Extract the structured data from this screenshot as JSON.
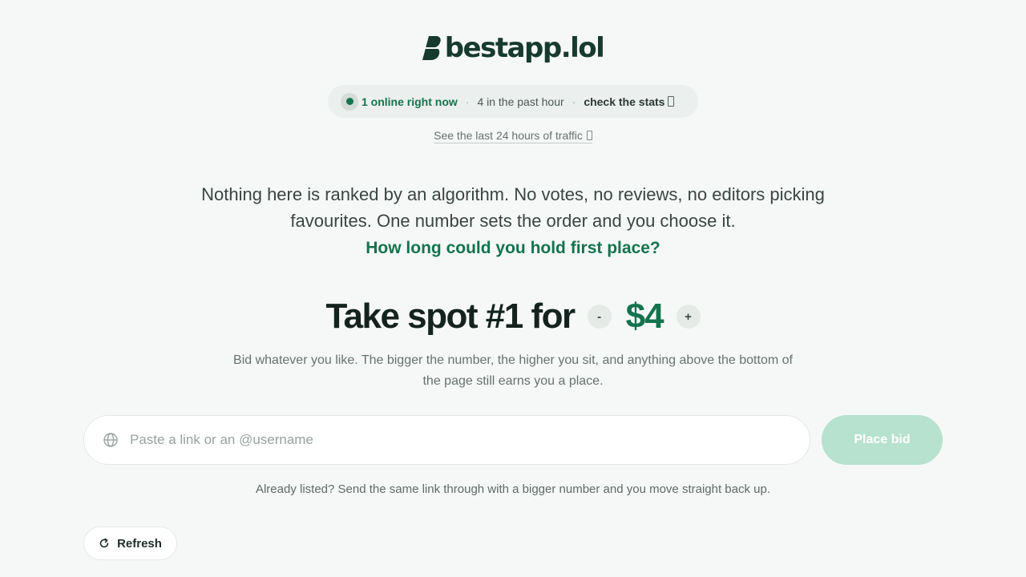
{
  "header": {
    "logo_text": "bestapp.lol",
    "brand_color": "#173a2f"
  },
  "status": {
    "online": "1 online right now",
    "separator": "·",
    "past_hour": "4 in the past hour",
    "stats_link": "check the stats"
  },
  "traffic_link": "See the last 24 hours of traffic",
  "intro": {
    "text": "Nothing here is ranked by an algorithm. No votes, no reviews, no editors picking favourites. One number sets the order and you choose it.",
    "question": "How long could you hold first place?"
  },
  "bid": {
    "heading": "Take spot #1 for",
    "decrement_label": "-",
    "amount": "$4",
    "increment_label": "+",
    "description": "Bid whatever you like. The bigger the number, the higher you sit, and anything above the bottom of the page still earns you a place."
  },
  "form": {
    "placeholder": "Paste a link or an @username",
    "value": "",
    "submit_label": "Place bid",
    "hint": "Already listed? Send the same link through with a bigger number and you move straight back up."
  },
  "refresh_label": "Refresh",
  "icons": {
    "logo": "leaf-b-logo-icon",
    "live": "live-dot-icon",
    "external": "external-link-icon",
    "input": "globe-icon",
    "refresh": "refresh-icon"
  },
  "colors": {
    "accent": "#14734f",
    "button_disabled": "#b6e2cf",
    "background": "#f6f8f7"
  }
}
